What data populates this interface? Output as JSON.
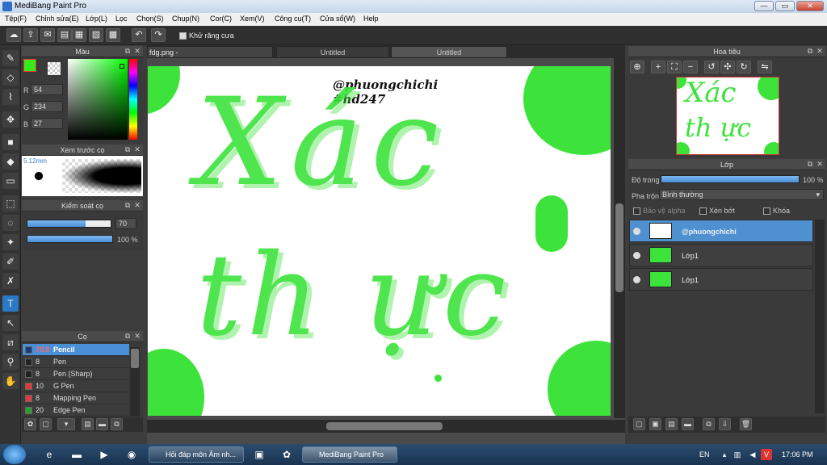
{
  "window": {
    "title": "MediBang Paint Pro",
    "btn_min": "—",
    "btn_max": "▭",
    "btn_close": "✕"
  },
  "menu": [
    "Tệp(F)",
    "Chỉnh sửa(E)",
    "Lớp(L)",
    "Lọc",
    "Chọn(S)",
    "Chụp(N)",
    "Cor(C)",
    "Xem(V)",
    "Công cụ(T)",
    "Cửa sổ(W)",
    "Help"
  ],
  "toolbar": {
    "antialias_label": "Khử răng cưa"
  },
  "color_panel": {
    "title": "Màu",
    "r_label": "R",
    "g_label": "G",
    "b_label": "B",
    "r": "54",
    "g": "234",
    "b": "27",
    "fg_color": "#36ea1b"
  },
  "brush_preview": {
    "title": "Xem trước cọ",
    "size": "5.12mm"
  },
  "brush_control": {
    "title": "Kiểm soát cọ",
    "size_value": "70",
    "opacity_value": "100 %",
    "size_fraction": 0.7,
    "opacity_fraction": 1.0
  },
  "brush_list": {
    "title": "Cọ",
    "items": [
      {
        "size": "70.0",
        "name": "Pencil",
        "color": "#1a3d7a",
        "selected": true
      },
      {
        "size": "8",
        "name": "Pen",
        "color": "#222222"
      },
      {
        "size": "8",
        "name": "Pen (Sharp)",
        "color": "#222222"
      },
      {
        "size": "10",
        "name": "G Pen",
        "color": "#e23b3b"
      },
      {
        "size": "8",
        "name": "Mapping Pen",
        "color": "#e23b3b"
      },
      {
        "size": "20",
        "name": "Edge Pen",
        "color": "#2ca02c"
      }
    ]
  },
  "tabs": [
    "fdg.png - C:/Users/Administrator/Desktop",
    "Untitled",
    "Untitled"
  ],
  "canvas": {
    "handle1": "@phuongchichi",
    "handle2": "#hd247",
    "line1": "Xác",
    "line2": "th ực"
  },
  "navigator": {
    "title": "Hoa tiêu"
  },
  "layers": {
    "title": "Lớp",
    "opacity_label": "Độ trong",
    "opacity_value": "100 %",
    "blend_label": "Pha trộn",
    "blend_value": "Bình thường",
    "protect_alpha": "Bảo vệ alpha",
    "clipping": "Xén bớt",
    "lock": "Khóa",
    "items": [
      {
        "name": "@phuongchichi",
        "selected": true
      },
      {
        "name": "Lớp1"
      },
      {
        "name": "Lớp1"
      }
    ]
  },
  "taskbar": {
    "tasks": [
      "Hỏi đáp môn Âm nh...",
      "MediBang Paint Pro"
    ],
    "lang": "EN",
    "time": "17:06 PM"
  }
}
